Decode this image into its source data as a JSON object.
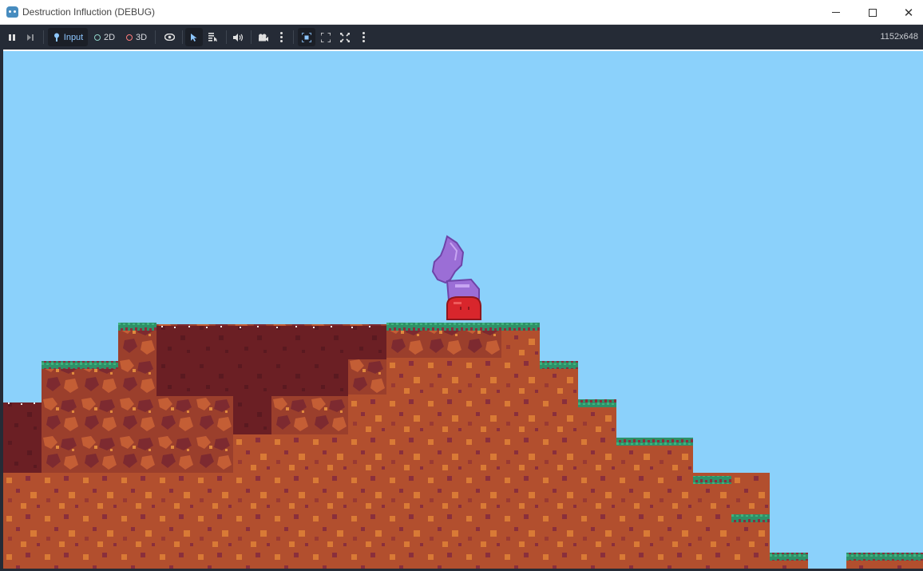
{
  "window": {
    "title": "Destruction Influction (DEBUG)",
    "icon": "godot-icon"
  },
  "toolbar": {
    "input_label": "Input",
    "mode_2d_label": "2D",
    "mode_3d_label": "3D",
    "resolution": "1152x648",
    "colors": {
      "accent": "#8ec7ff",
      "2d": "#8fd3c8",
      "3d": "#ff7b7b"
    }
  },
  "scene": {
    "sky_color": "#8bd1fb",
    "dirt_color": "#b24f2e",
    "grass_color": "#2e9168",
    "dark_dirt_color": "#6b1f24",
    "player": "purple-horned-creature",
    "enemy": "red-slime"
  }
}
